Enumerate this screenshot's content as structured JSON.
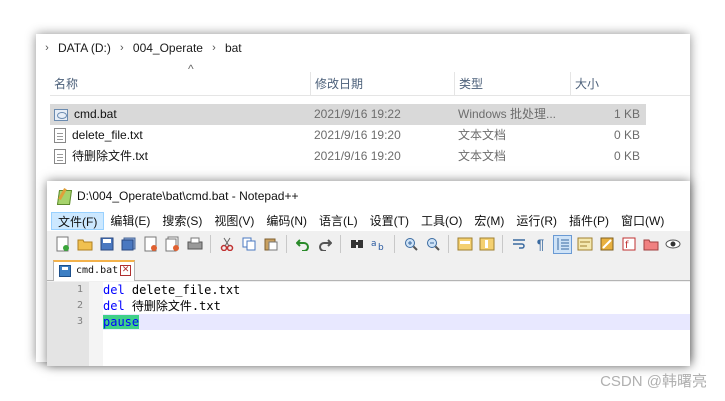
{
  "explorer": {
    "breadcrumb": [
      "DATA (D:)",
      "004_Operate",
      "bat"
    ],
    "columns": {
      "name": "名称",
      "modified": "修改日期",
      "type": "类型",
      "size": "大小"
    },
    "files": [
      {
        "name": "cmd.bat",
        "modified": "2021/9/16 19:22",
        "type": "Windows 批处理...",
        "size": "1 KB",
        "icon": "bat-file-icon"
      },
      {
        "name": "delete_file.txt",
        "modified": "2021/9/16 19:20",
        "type": "文本文档",
        "size": "0 KB",
        "icon": "text-file-icon"
      },
      {
        "name": "待删除文件.txt",
        "modified": "2021/9/16 19:20",
        "type": "文本文档",
        "size": "0 KB",
        "icon": "text-file-icon"
      }
    ]
  },
  "npp": {
    "title": "D:\\004_Operate\\bat\\cmd.bat - Notepad++",
    "menu": [
      "文件(F)",
      "编辑(E)",
      "搜索(S)",
      "视图(V)",
      "编码(N)",
      "语言(L)",
      "设置(T)",
      "工具(O)",
      "宏(M)",
      "运行(R)",
      "插件(P)",
      "窗口(W)"
    ],
    "tab": "cmd.bat",
    "lines": [
      {
        "num": "1",
        "kw": "del",
        "rest": " delete_file.txt"
      },
      {
        "num": "2",
        "kw": "del",
        "rest": " 待删除文件.txt"
      },
      {
        "num": "3",
        "kw": "pause",
        "rest": ""
      }
    ]
  },
  "watermark": "CSDN @韩曙亮",
  "colors": {
    "selected_row": "#d9d9d9",
    "keyword": "#0000ff",
    "current_line": "#e8e8ff",
    "word_highlight": "#3fd08a",
    "tab_accent": "#f3b24b"
  }
}
